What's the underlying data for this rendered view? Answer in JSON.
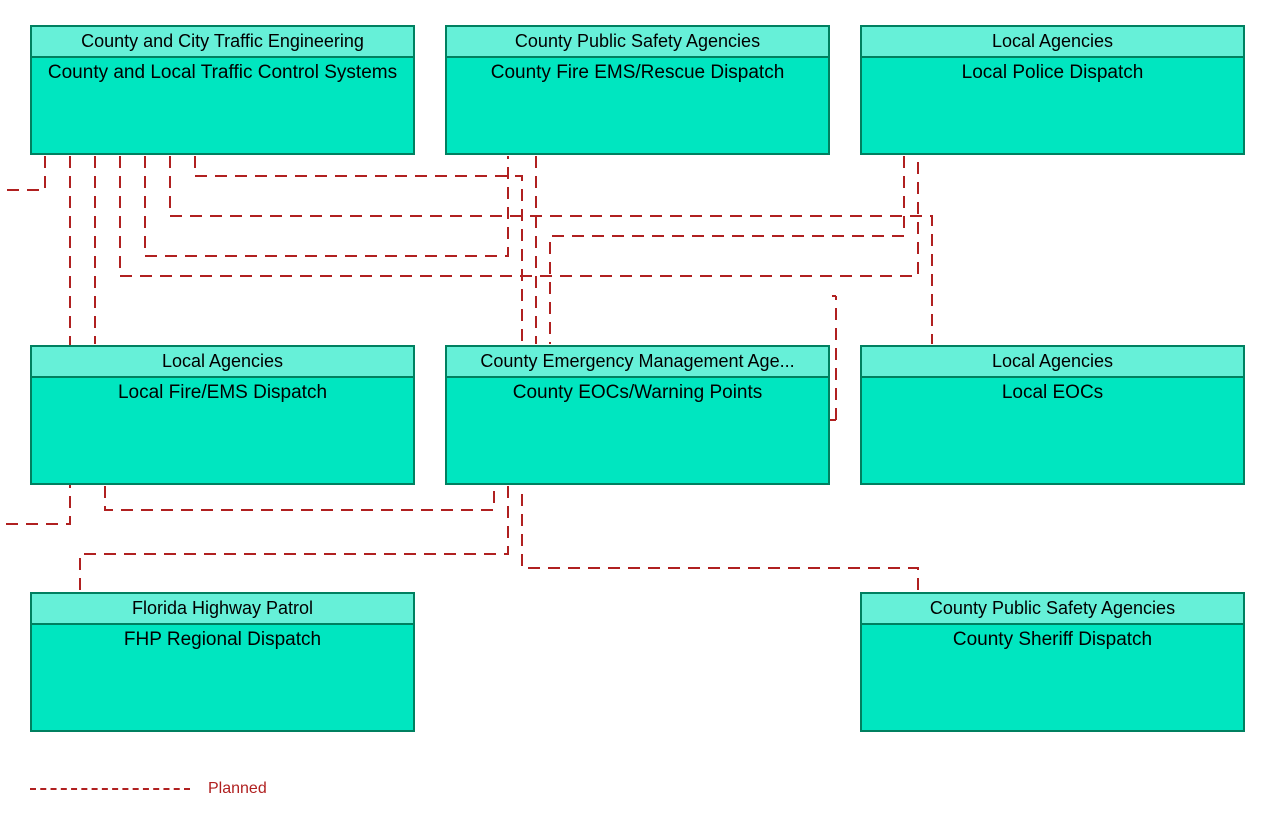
{
  "colors": {
    "node_fill": "#00e6c0",
    "node_header_fill": "#66f0d8",
    "node_border": "#008060",
    "line": "#b02020"
  },
  "legend": {
    "label": "Planned"
  },
  "nodes": {
    "traffic": {
      "header": "County and City Traffic Engineering",
      "body": "County and Local Traffic Control Systems"
    },
    "county_fire": {
      "header": "County Public Safety Agencies",
      "body": "County Fire EMS/Rescue Dispatch"
    },
    "local_police": {
      "header": "Local Agencies",
      "body": "Local Police Dispatch"
    },
    "local_fire": {
      "header": "Local Agencies",
      "body": "Local Fire/EMS Dispatch"
    },
    "county_eoc": {
      "header": "County Emergency Management Age...",
      "body": "County EOCs/Warning Points"
    },
    "local_eoc": {
      "header": "Local Agencies",
      "body": "Local EOCs"
    },
    "fhp": {
      "header": "Florida Highway Patrol",
      "body": "FHP Regional Dispatch"
    },
    "sheriff": {
      "header": "County Public Safety Agencies",
      "body": "County Sheriff Dispatch"
    }
  }
}
